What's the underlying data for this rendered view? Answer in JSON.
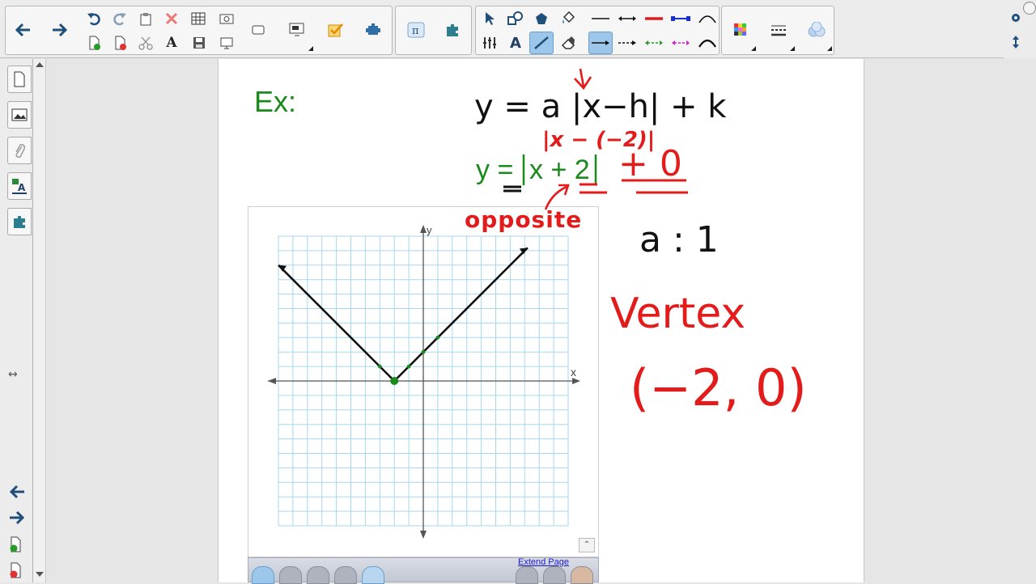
{
  "toolbar": {
    "nav": [
      {
        "name": "back-arrow-icon",
        "glyph": "🡐"
      },
      {
        "name": "forward-arrow-icon",
        "glyph": "🡒"
      }
    ],
    "colors": {
      "ink_black": "#111111",
      "ink_red": "#e31b1b",
      "ink_green": "#1a8a1a",
      "accent_blue": "#3a8fd6",
      "grid_blue": "#a6d7ee",
      "active_tool_bg": "#9cc7ea"
    }
  },
  "sidebar": {
    "tabs": [
      {
        "name": "page-sorter-tab",
        "icon": "page-icon"
      },
      {
        "name": "gallery-tab",
        "icon": "image-icon"
      },
      {
        "name": "attachments-tab",
        "icon": "paperclip-icon"
      },
      {
        "name": "properties-tab",
        "icon": "properties-icon"
      },
      {
        "name": "addons-tab",
        "icon": "puzzle-icon"
      }
    ]
  },
  "page": {
    "ex_label": "Ex:",
    "formula_general": "y = a |x−h| + k",
    "substitution": "|x − (−2)|",
    "formula_specific_main": "y = ",
    "formula_specific_abs": "x + 2",
    "plus_zero": "+ 0",
    "opposite_note": "opposite",
    "a_value": "a : 1",
    "vertex_label": "Vertex",
    "vertex_coords": "(−2, 0)",
    "extend_page": "Extend Page"
  },
  "graph": {
    "x_axis_label": "x",
    "y_axis_label": "y",
    "vertex": [
      -2,
      0
    ],
    "points": [
      [
        -3,
        1
      ],
      [
        -2,
        0
      ],
      [
        -1,
        1
      ],
      [
        0,
        2
      ],
      [
        1,
        3
      ]
    ]
  }
}
